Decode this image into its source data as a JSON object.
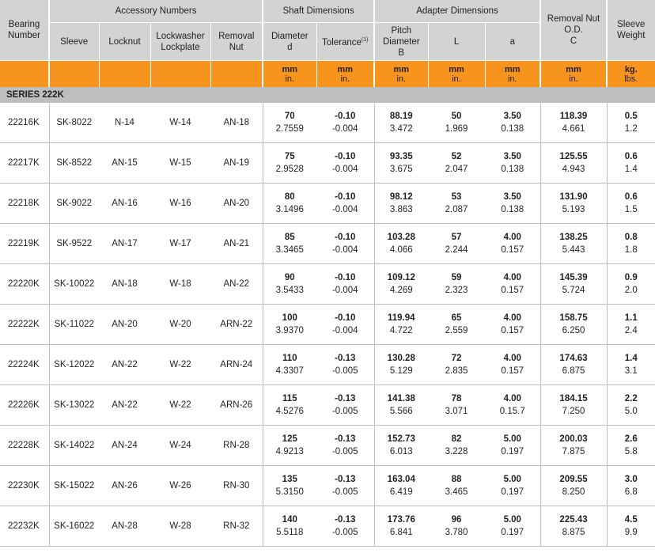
{
  "headers": {
    "bearing_number": "Bearing Number",
    "accessory_numbers": "Accessory Numbers",
    "sleeve": "Sleeve",
    "locknut": "Locknut",
    "lockwasher_lockplate": "Lockwasher Lockplate",
    "removal_nut": "Removal Nut",
    "shaft_dimensions": "Shaft Dimensions",
    "diameter": "Diameter",
    "diameter_sym": "d",
    "tolerance": "Tolerance",
    "tolerance_note": "(1)",
    "adapter_dimensions": "Adapter Dimensions",
    "pitch_diameter": "Pitch Diameter",
    "pitch_sym": "B",
    "l": "L",
    "a": "a",
    "removal_nut_od": "Removal Nut O.D.",
    "removal_sym": "C",
    "sleeve_weight": "Sleeve Weight"
  },
  "units": {
    "mm": "mm",
    "in": "in.",
    "kg": "kg.",
    "lbs": "lbs."
  },
  "series_label": "SERIES 222K",
  "rows": [
    {
      "bearing": "22216K",
      "sleeve": "SK-8022",
      "locknut": "N-14",
      "lockwasher": "W-14",
      "removal": "AN-18",
      "d_mm": "70",
      "d_in": "2.7559",
      "tol_mm": "-0.10",
      "tol_in": "-0.004",
      "b_mm": "88.19",
      "b_in": "3.472",
      "l_mm": "50",
      "l_in": "1.969",
      "a_mm": "3.50",
      "a_in": "0.138",
      "c_mm": "118.39",
      "c_in": "4.661",
      "kg": "0.5",
      "lbs": "1.2"
    },
    {
      "bearing": "22217K",
      "sleeve": "SK-8522",
      "locknut": "AN-15",
      "lockwasher": "W-15",
      "removal": "AN-19",
      "d_mm": "75",
      "d_in": "2.9528",
      "tol_mm": "-0.10",
      "tol_in": "-0.004",
      "b_mm": "93.35",
      "b_in": "3.675",
      "l_mm": "52",
      "l_in": "2.047",
      "a_mm": "3.50",
      "a_in": "0.138",
      "c_mm": "125.55",
      "c_in": "4.943",
      "kg": "0.6",
      "lbs": "1.4"
    },
    {
      "bearing": "22218K",
      "sleeve": "SK-9022",
      "locknut": "AN-16",
      "lockwasher": "W-16",
      "removal": "AN-20",
      "d_mm": "80",
      "d_in": "3.1496",
      "tol_mm": "-0.10",
      "tol_in": "-0.004",
      "b_mm": "98.12",
      "b_in": "3.863",
      "l_mm": "53",
      "l_in": "2.087",
      "a_mm": "3.50",
      "a_in": "0.138",
      "c_mm": "131.90",
      "c_in": "5.193",
      "kg": "0.6",
      "lbs": "1.5"
    },
    {
      "bearing": "22219K",
      "sleeve": "SK-9522",
      "locknut": "AN-17",
      "lockwasher": "W-17",
      "removal": "AN-21",
      "d_mm": "85",
      "d_in": "3.3465",
      "tol_mm": "-0.10",
      "tol_in": "-0.004",
      "b_mm": "103.28",
      "b_in": "4.066",
      "l_mm": "57",
      "l_in": "2.244",
      "a_mm": "4.00",
      "a_in": "0.157",
      "c_mm": "138.25",
      "c_in": "5.443",
      "kg": "0.8",
      "lbs": "1.8"
    },
    {
      "bearing": "22220K",
      "sleeve": "SK-10022",
      "locknut": "AN-18",
      "lockwasher": "W-18",
      "removal": "AN-22",
      "d_mm": "90",
      "d_in": "3.5433",
      "tol_mm": "-0.10",
      "tol_in": "-0.004",
      "b_mm": "109.12",
      "b_in": "4.269",
      "l_mm": "59",
      "l_in": "2.323",
      "a_mm": "4.00",
      "a_in": "0.157",
      "c_mm": "145.39",
      "c_in": "5.724",
      "kg": "0.9",
      "lbs": "2.0"
    },
    {
      "bearing": "22222K",
      "sleeve": "SK-11022",
      "locknut": "AN-20",
      "lockwasher": "W-20",
      "removal": "ARN-22",
      "d_mm": "100",
      "d_in": "3.9370",
      "tol_mm": "-0.10",
      "tol_in": "-0.004",
      "b_mm": "119.94",
      "b_in": "4.722",
      "l_mm": "65",
      "l_in": "2.559",
      "a_mm": "4.00",
      "a_in": "0.157",
      "c_mm": "158.75",
      "c_in": "6.250",
      "kg": "1.1",
      "lbs": "2.4"
    },
    {
      "bearing": "22224K",
      "sleeve": "SK-12022",
      "locknut": "AN-22",
      "lockwasher": "W-22",
      "removal": "ARN-24",
      "d_mm": "110",
      "d_in": "4.3307",
      "tol_mm": "-0.13",
      "tol_in": "-0.005",
      "b_mm": "130.28",
      "b_in": "5.129",
      "l_mm": "72",
      "l_in": "2.835",
      "a_mm": "4.00",
      "a_in": "0.157",
      "c_mm": "174.63",
      "c_in": "6.875",
      "kg": "1.4",
      "lbs": "3.1"
    },
    {
      "bearing": "22226K",
      "sleeve": "SK-13022",
      "locknut": "AN-22",
      "lockwasher": "W-22",
      "removal": "ARN-26",
      "d_mm": "115",
      "d_in": "4.5276",
      "tol_mm": "-0.13",
      "tol_in": "-0.005",
      "b_mm": "141.38",
      "b_in": "5.566",
      "l_mm": "78",
      "l_in": "3.071",
      "a_mm": "4.00",
      "a_in": "0.15.7",
      "c_mm": "184.15",
      "c_in": "7.250",
      "kg": "2.2",
      "lbs": "5.0"
    },
    {
      "bearing": "22228K",
      "sleeve": "SK-14022",
      "locknut": "AN-24",
      "lockwasher": "W-24",
      "removal": "RN-28",
      "d_mm": "125",
      "d_in": "4.9213",
      "tol_mm": "-0.13",
      "tol_in": "-0.005",
      "b_mm": "152.73",
      "b_in": "6.013",
      "l_mm": "82",
      "l_in": "3.228",
      "a_mm": "5.00",
      "a_in": "0.197",
      "c_mm": "200.03",
      "c_in": "7.875",
      "kg": "2.6",
      "lbs": "5.8"
    },
    {
      "bearing": "22230K",
      "sleeve": "SK-15022",
      "locknut": "AN-26",
      "lockwasher": "W-26",
      "removal": "RN-30",
      "d_mm": "135",
      "d_in": "5.3150",
      "tol_mm": "-0.13",
      "tol_in": "-0.005",
      "b_mm": "163.04",
      "b_in": "6.419",
      "l_mm": "88",
      "l_in": "3.465",
      "a_mm": "5.00",
      "a_in": "0.197",
      "c_mm": "209.55",
      "c_in": "8.250",
      "kg": "3.0",
      "lbs": "6.8"
    },
    {
      "bearing": "22232K",
      "sleeve": "SK-16022",
      "locknut": "AN-28",
      "lockwasher": "W-28",
      "removal": "RN-32",
      "d_mm": "140",
      "d_in": "5.5118",
      "tol_mm": "-0.13",
      "tol_in": "-0.005",
      "b_mm": "173.76",
      "b_in": "6.841",
      "l_mm": "96",
      "l_in": "3.780",
      "a_mm": "5.00",
      "a_in": "0.197",
      "c_mm": "225.43",
      "c_in": "8.875",
      "kg": "4.5",
      "lbs": "9.9"
    }
  ],
  "colors": {
    "header_gray": "#d1d3d4",
    "unit_orange": "#f7941d",
    "series_gray": "#bcbec0"
  }
}
